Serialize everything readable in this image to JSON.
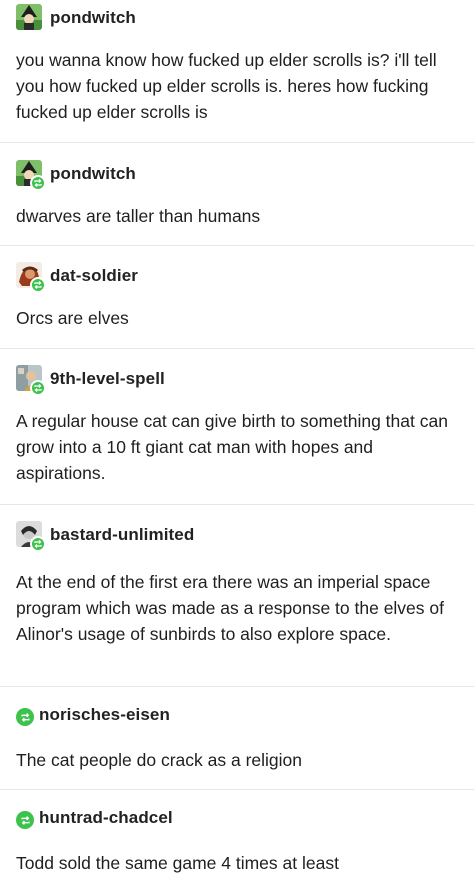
{
  "posts": [
    {
      "username": "pondwitch",
      "avatar_icon": "witch-avatar-icon",
      "reblog": false,
      "text": "you wanna know how fucked up elder scrolls is? i'll tell you how fucked up elder scrolls is. heres how fucking fucked up elder scrolls is"
    },
    {
      "username": "pondwitch",
      "avatar_icon": "witch-avatar-icon",
      "reblog": true,
      "text": "dwarves are taller than humans"
    },
    {
      "username": "dat-soldier",
      "avatar_icon": "soldier-avatar-icon",
      "reblog": true,
      "text": "Orcs are elves"
    },
    {
      "username": "9th-level-spell",
      "avatar_icon": "spell-avatar-icon",
      "reblog": true,
      "text": "A regular house cat can give birth to something that can grow into a 10 ft giant cat man with hopes and aspirations."
    },
    {
      "username": "bastard-unlimited",
      "avatar_icon": "bastard-avatar-icon",
      "reblog": true,
      "text": "At the end of the first era there was an imperial space program which was made as a response to the elves of Alinor's usage of sunbirds to also explore space."
    },
    {
      "username": "norisches-eisen",
      "avatar_icon": "reblog-icon",
      "reblog": true,
      "text": "The cat people do crack as a religion"
    },
    {
      "username": "huntrad-chadcel",
      "avatar_icon": "reblog-icon",
      "reblog": true,
      "text": "Todd sold the same game 4 times at least"
    }
  ],
  "colors": {
    "reblog_badge": "#3cc24d",
    "divider": "#e6e6e6",
    "username": "#222222",
    "body_text": "#1f1f1f"
  }
}
